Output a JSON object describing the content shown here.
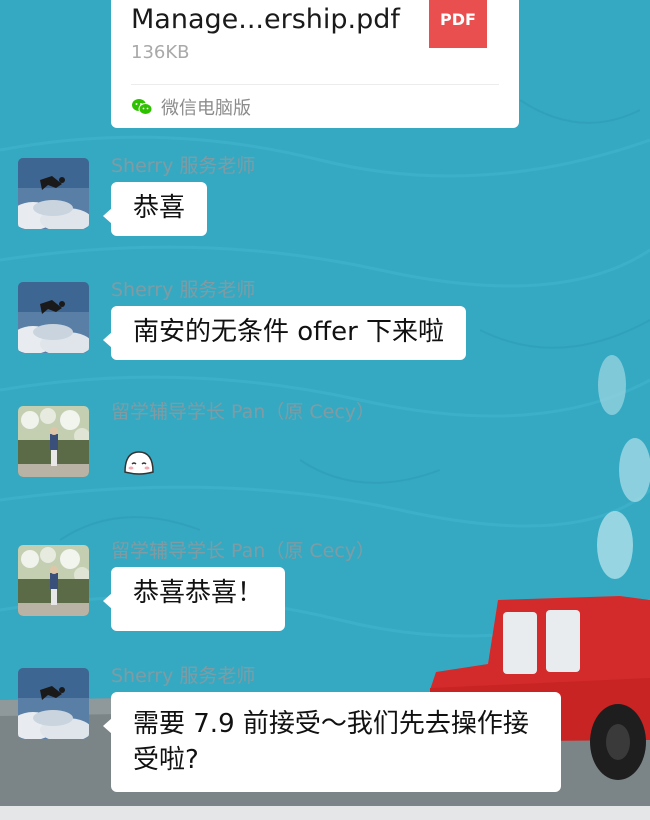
{
  "file": {
    "name": "Manage...ership.pdf",
    "size": "136KB",
    "type_label": "PDF",
    "source": "微信电脑版",
    "source_icon": "wechat-icon"
  },
  "messages": [
    {
      "sender": "Sherry 服务老师",
      "avatar": "skydiver-avatar",
      "text": "恭喜"
    },
    {
      "sender": "Sherry 服务老师",
      "avatar": "skydiver-avatar",
      "text": "南安的无条件 offer 下来啦"
    },
    {
      "sender": "留学辅导学长 Pan（原 Cecy）",
      "avatar": "person-garden-avatar",
      "sticker": "blushing-face-sticker"
    },
    {
      "sender": "留学辅导学长 Pan（原 Cecy）",
      "avatar": "person-garden-avatar",
      "text": "恭喜恭喜！"
    },
    {
      "sender": "Sherry 服务老师",
      "avatar": "skydiver-avatar",
      "text": "需要 7.9 前接受～我们先去操作接受啦?"
    }
  ],
  "colors": {
    "chat_background": "#35a9c2",
    "bubble": "#ffffff",
    "sender_name": "#7f9ca4",
    "pdf_badge": "#e94f4f",
    "wechat_green": "#2dc100",
    "car": "#d32b2b"
  }
}
